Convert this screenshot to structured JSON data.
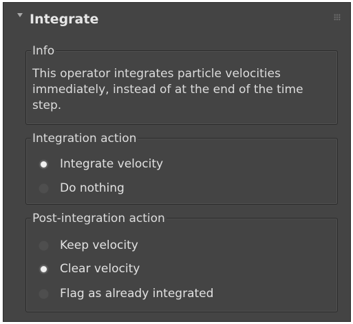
{
  "panel": {
    "title": "Integrate",
    "collapse_icon": "triangle-down",
    "grip_icon": "dots-grip"
  },
  "info": {
    "label": "Info",
    "text": "This operator integrates particle velocities immediately, instead of at the end of the time step."
  },
  "integration_action": {
    "label": "Integration action",
    "options": [
      {
        "label": "Integrate velocity",
        "selected": true
      },
      {
        "label": "Do nothing",
        "selected": false
      }
    ]
  },
  "post_integration_action": {
    "label": "Post-integration action",
    "options": [
      {
        "label": "Keep velocity",
        "selected": false
      },
      {
        "label": "Clear velocity",
        "selected": true
      },
      {
        "label": "Flag as already integrated",
        "selected": false
      }
    ]
  },
  "colors": {
    "panel_bg": "#444444",
    "text": "#dcdcdc",
    "radio_selected": "#f0f0f0"
  }
}
